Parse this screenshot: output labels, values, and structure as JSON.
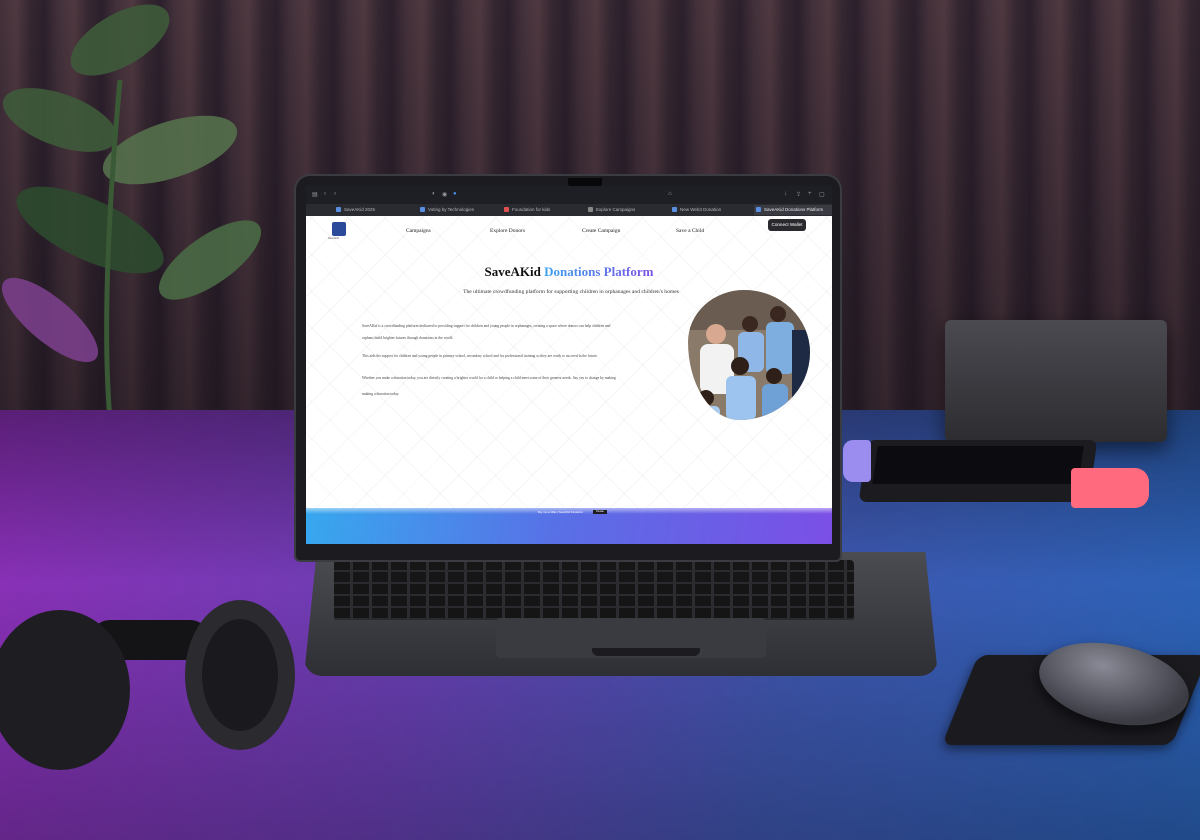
{
  "browser": {
    "url": "",
    "tabs": [
      {
        "label": "SaveAKid 2025"
      },
      {
        "label": "Voting by Technologies"
      },
      {
        "label": "Foundation for kids"
      },
      {
        "label": "Explore Campaigns"
      },
      {
        "label": "New Web3 Donation"
      },
      {
        "label": "SaveAKid Donations Platform"
      }
    ]
  },
  "site": {
    "logo_caption": "SaveAKid",
    "nav": {
      "campaigns": "Campaigns",
      "explore_donors": "Explore Donors",
      "create_campaign": "Create Campaign",
      "save_a_child": "Save a Child",
      "wallet_button": "Connect Wallet"
    },
    "hero": {
      "title_plain": "SaveAKid",
      "title_gradient": "Donations Platform",
      "subtitle": "The ultimate crowdfunding platform for supporting children in orphanages and children's homes"
    },
    "paragraphs": [
      "SaveAKid is a crowdfunding platform dedicated to providing support for children and young people in orphanages, creating a space where donors can help children and",
      "orphans build brighter futures through donations in the world.",
      "This aids the support for children and young people in primary school, secondary school and for professional training so they are ready to succeed in the future.",
      "Whether you make a donation today, you are directly creating a brighter world for a child or helping a child meet some of their greatest needs. Say yes to change by making",
      "making a donation today."
    ],
    "footer": {
      "text": "Buy me a coffee | SaveAKid Donations",
      "button": "Donate"
    }
  },
  "colors": {
    "accent_blue": "#3aa2ef",
    "accent_purple": "#7b4fe6",
    "nav_button_bg": "#2a2a2e"
  }
}
